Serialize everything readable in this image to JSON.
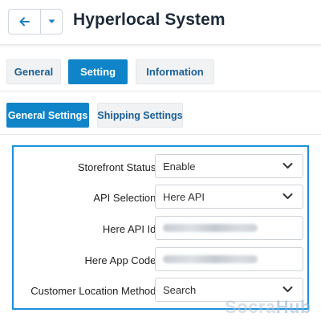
{
  "header": {
    "title": "Hyperlocal System",
    "back_icon": "arrow-left-icon",
    "dropdown_icon": "caret-down-icon"
  },
  "tabs": [
    {
      "label": "General",
      "active": false
    },
    {
      "label": "Setting",
      "active": true
    },
    {
      "label": "Information",
      "active": false
    }
  ],
  "subtabs": [
    {
      "label": "General Settings",
      "active": true
    },
    {
      "label": "Shipping Settings",
      "active": false
    }
  ],
  "form": {
    "fields": [
      {
        "label": "Storefront Status:",
        "type": "select",
        "value": "Enable"
      },
      {
        "label": "API Selection:",
        "type": "select",
        "value": "Here API"
      },
      {
        "label": "Here API Id:",
        "type": "text",
        "value": "",
        "masked": true
      },
      {
        "label": "Here App Code:",
        "type": "text",
        "value": "",
        "masked": true
      },
      {
        "label": "Customer Location Method:",
        "type": "select",
        "value": "Search"
      }
    ]
  },
  "watermark": {
    "part1": "Socra",
    "part2": "Hub"
  },
  "colors": {
    "accent": "#0f84c8",
    "focus_border": "#1e8fdc",
    "title": "#1e2b3a",
    "tab_text": "#1a5f97"
  }
}
